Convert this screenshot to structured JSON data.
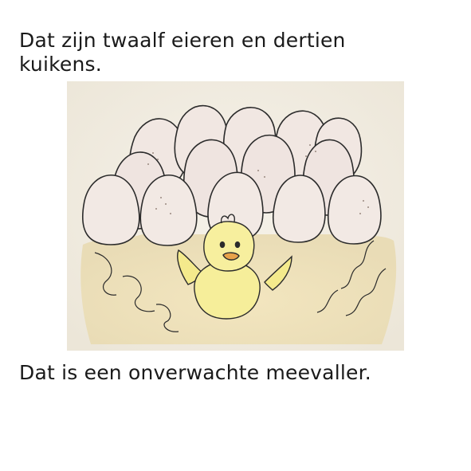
{
  "page": {
    "top_text": "Dat zijn twaalf eieren en dertien kuikens.",
    "bottom_text": "Dat is een onverwachte meevaller."
  },
  "illustration": {
    "subject_icon": "eggs-and-chick-drawing",
    "colors": {
      "background": "#f3efe6",
      "straw": "#efe2b8",
      "egg_fill": "#f1e7e2",
      "egg_stroke": "#2b2b2b",
      "chick": "#f4ea8c",
      "beak": "#e8a24a"
    }
  }
}
